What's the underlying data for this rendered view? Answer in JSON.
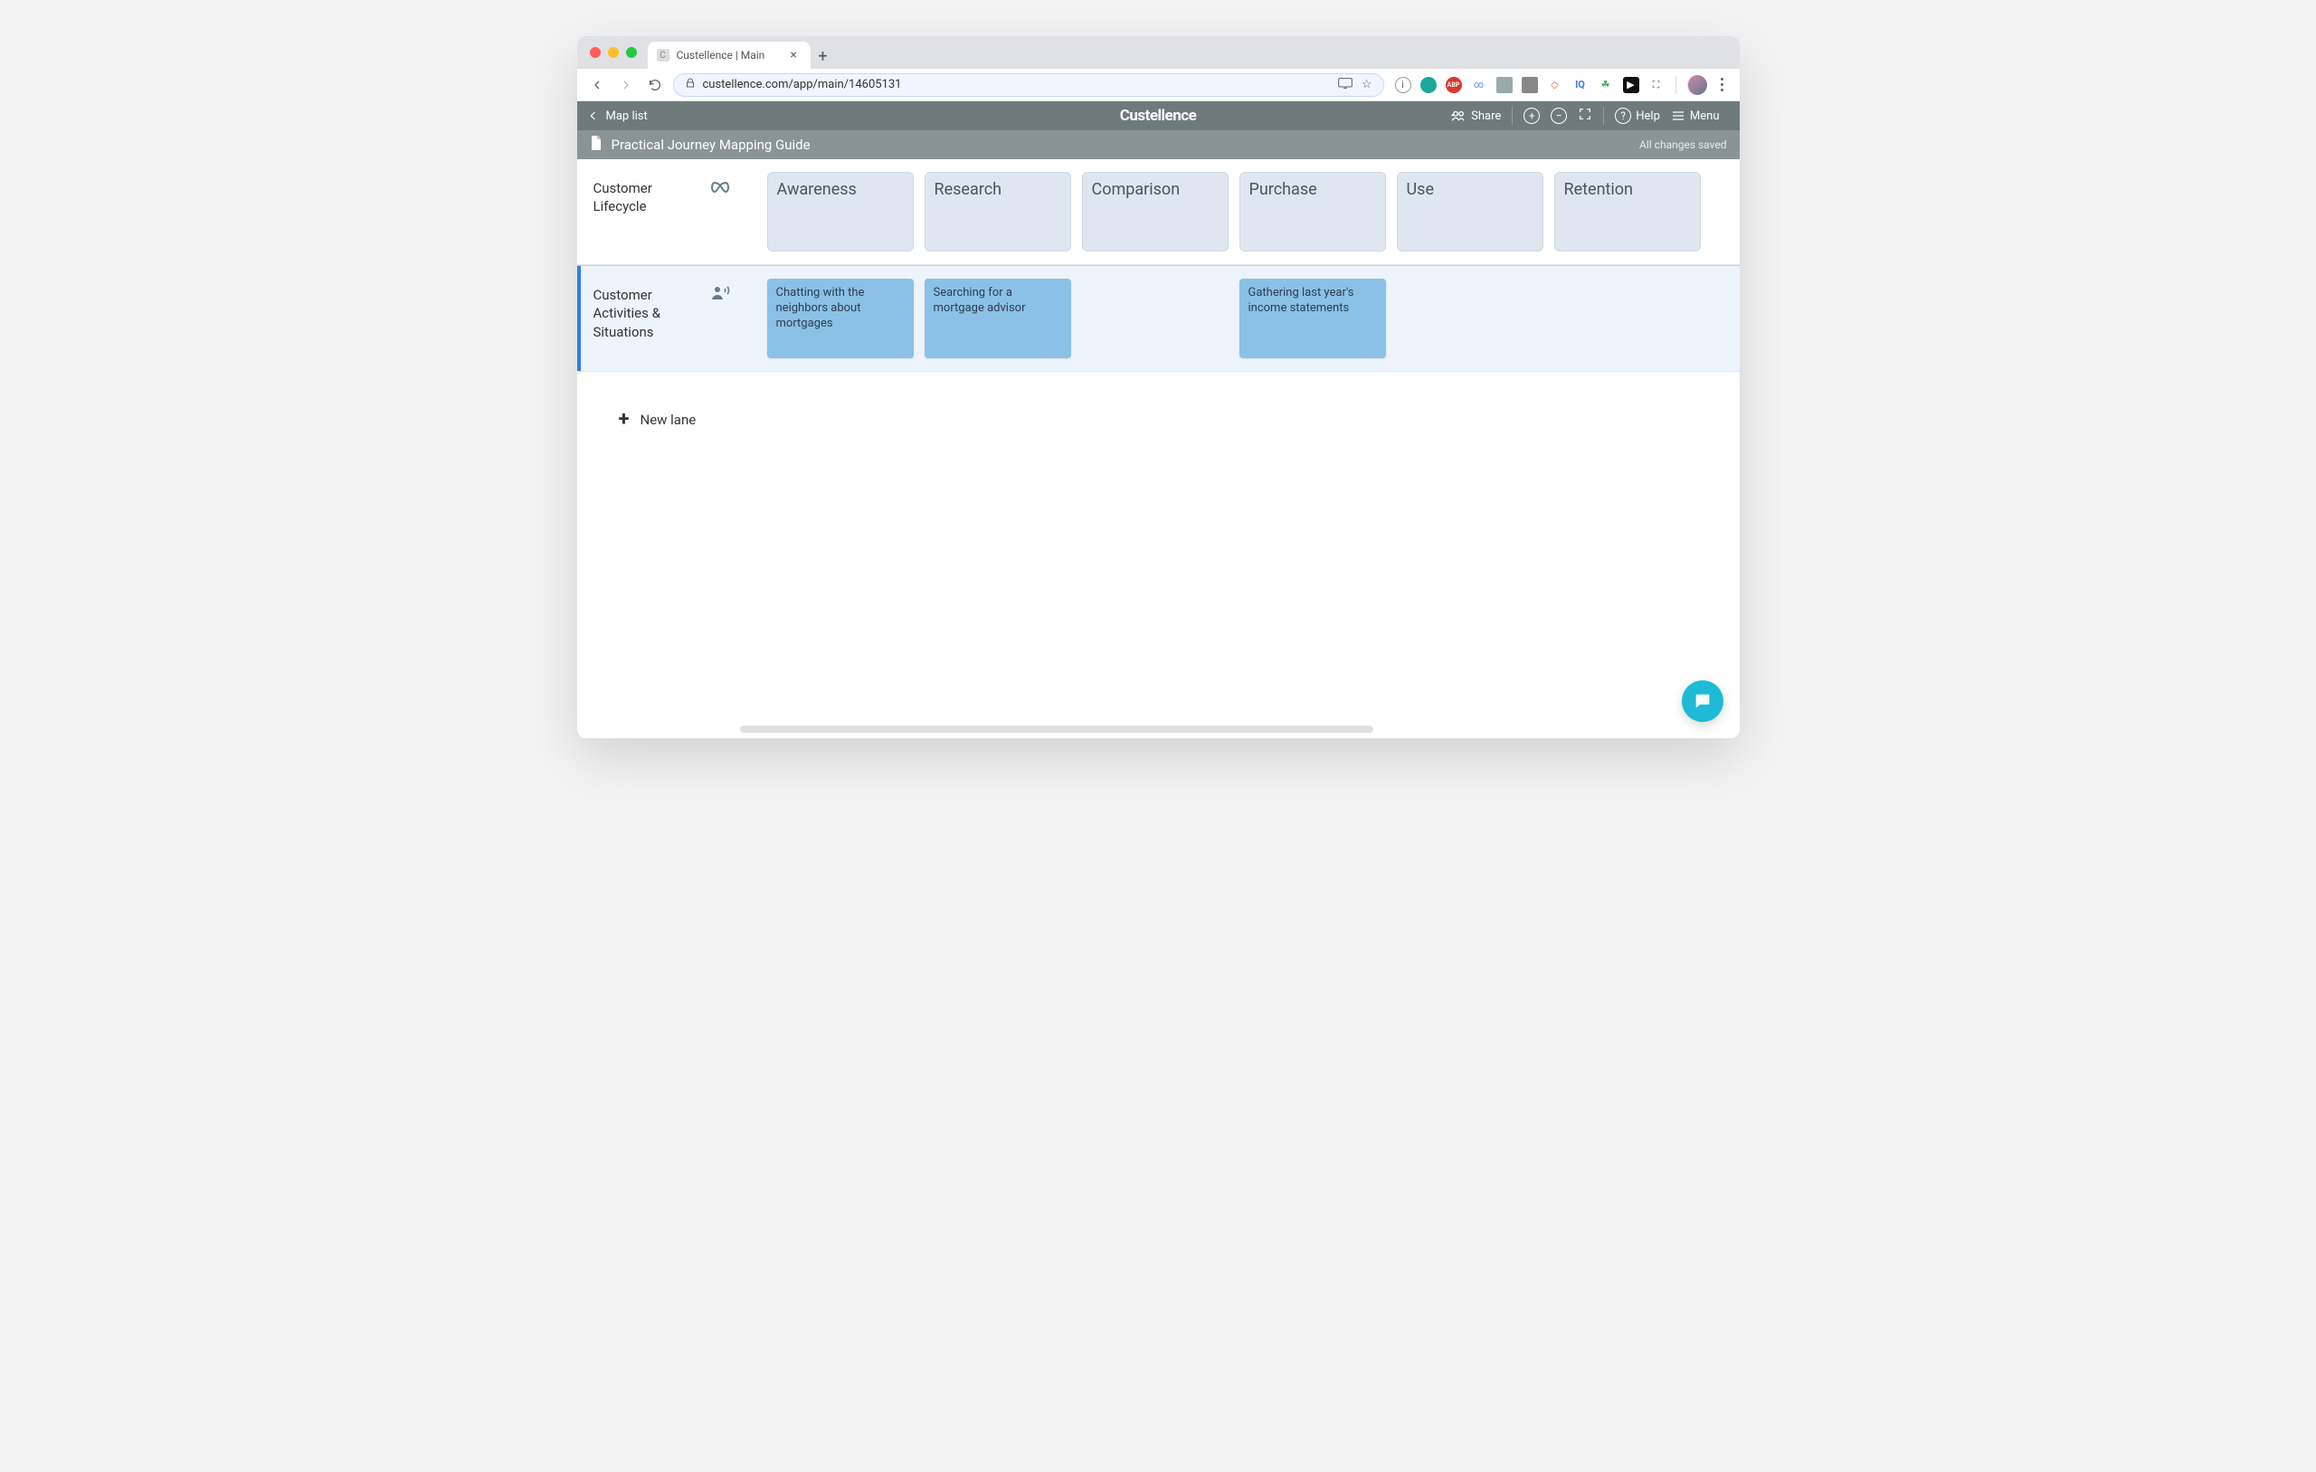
{
  "browser": {
    "tab_title": "Custellence | Main",
    "url": "custellence.com/app/main/14605131"
  },
  "app_header": {
    "back_label": "Map list",
    "brand": "Custellence",
    "share_label": "Share",
    "help_label": "Help",
    "menu_label": "Menu"
  },
  "subheader": {
    "doc_title": "Practical Journey Mapping Guide",
    "save_status": "All changes saved"
  },
  "lanes": [
    {
      "title": "Customer Lifecycle",
      "icon": "infinity",
      "selected": false,
      "cards": [
        {
          "type": "stage",
          "text": "Awareness"
        },
        {
          "type": "stage",
          "text": "Research"
        },
        {
          "type": "stage",
          "text": "Comparison"
        },
        {
          "type": "stage",
          "text": "Purchase"
        },
        {
          "type": "stage",
          "text": "Use"
        },
        {
          "type": "stage",
          "text": "Retention"
        }
      ]
    },
    {
      "title": "Customer Activities & Situations",
      "icon": "person-voice",
      "selected": true,
      "cards": [
        {
          "type": "activity",
          "text": "Chatting with the neighbors about mortgages"
        },
        {
          "type": "activity",
          "text": "Searching for a mortgage advisor"
        },
        {
          "type": "spacer",
          "text": ""
        },
        {
          "type": "activity",
          "text": "Gathering last year's income statements"
        }
      ]
    }
  ],
  "new_lane_label": "New lane",
  "ext_labels": {
    "info": "ⓘ",
    "teal": "",
    "abp": "ABP",
    "link": "",
    "chat": "",
    "video": "",
    "flag": "",
    "iq": "IQ",
    "leaf": "",
    "play": "",
    "crop": ""
  }
}
